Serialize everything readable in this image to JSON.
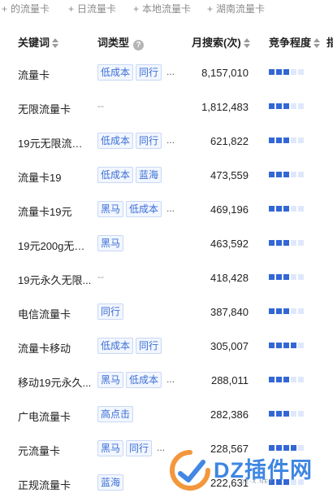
{
  "filters": [
    {
      "label": "的流量卡"
    },
    {
      "label": "日流量卡"
    },
    {
      "label": "本地流量卡"
    },
    {
      "label": "湖南流量卡"
    }
  ],
  "table": {
    "headers": {
      "keyword": "关键词",
      "type": "词类型",
      "monthly_search": "月搜索(次)",
      "competition": "竞争程度",
      "extra": "指"
    },
    "rows": [
      {
        "keyword": "流量卡",
        "tags": [
          "低成本",
          "同行"
        ],
        "more": "...",
        "search": "8,157,010",
        "competition": 3
      },
      {
        "keyword": "无限流量卡",
        "tags": [],
        "dash": "--",
        "search": "1,812,483",
        "competition": 3
      },
      {
        "keyword": "19元无限流量卡",
        "tags": [
          "低成本",
          "同行"
        ],
        "more": "...",
        "search": "621,822",
        "competition": 3
      },
      {
        "keyword": "流量卡19",
        "tags": [
          "低成本",
          "蓝海"
        ],
        "search": "473,559",
        "competition": 3
      },
      {
        "keyword": "流量卡19元",
        "tags": [
          "黑马",
          "低成本"
        ],
        "more": "...",
        "search": "469,196",
        "competition": 3
      },
      {
        "keyword": "19元200g无限...",
        "tags": [
          "黑马"
        ],
        "search": "463,592",
        "competition": 3
      },
      {
        "keyword": "19元永久无限...",
        "tags": [],
        "dash": "--",
        "search": "418,428",
        "competition": 3
      },
      {
        "keyword": "电信流量卡",
        "tags": [
          "同行"
        ],
        "search": "387,840",
        "competition": 3
      },
      {
        "keyword": "流量卡移动",
        "tags": [
          "低成本",
          "同行"
        ],
        "search": "305,007",
        "competition": 4
      },
      {
        "keyword": "移动19元永久...",
        "tags": [
          "黑马",
          "低成本"
        ],
        "more": "...",
        "search": "288,011",
        "competition": 3
      },
      {
        "keyword": "广电流量卡",
        "tags": [
          "高点击"
        ],
        "search": "282,386",
        "competition": 3
      },
      {
        "keyword": "元流量卡",
        "tags": [
          "黑马",
          "同行"
        ],
        "more": "...",
        "search": "228,567",
        "competition": 4
      },
      {
        "keyword": "正规流量卡",
        "tags": [
          "蓝海"
        ],
        "search": "222,631",
        "competition": 3
      }
    ],
    "competition_max": 5
  },
  "watermark": {
    "text": "DZ插件网",
    "sub": "DZ-X.NET"
  },
  "colors": {
    "accent": "#3367d6",
    "tag_text": "#3b6fd6",
    "tag_bg": "#f2f6fe",
    "muted": "#8a8a8a"
  }
}
